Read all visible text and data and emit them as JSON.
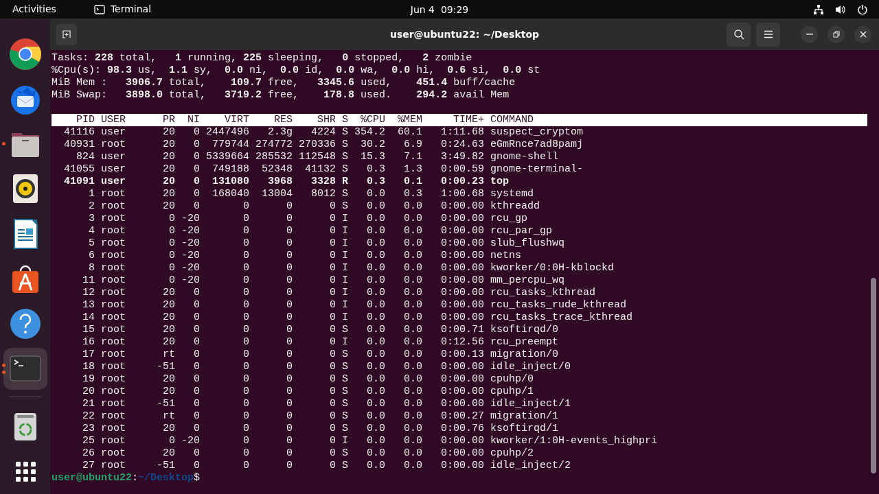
{
  "top_bar": {
    "activities": "Activities",
    "app": "Terminal",
    "clock": "Jun 4  09:29"
  },
  "dock": {
    "items": [
      {
        "kind": "browser",
        "running": false,
        "multiple_windows": false,
        "selected": false
      },
      {
        "kind": "mail",
        "running": false,
        "multiple_windows": false,
        "selected": false
      },
      {
        "kind": "files",
        "running": true,
        "multiple_windows": false,
        "selected": false
      },
      {
        "kind": "music",
        "running": false,
        "multiple_windows": false,
        "selected": false
      },
      {
        "kind": "writer",
        "running": false,
        "multiple_windows": false,
        "selected": false
      },
      {
        "kind": "store",
        "running": false,
        "multiple_windows": false,
        "selected": false
      },
      {
        "kind": "help",
        "running": false,
        "multiple_windows": false,
        "selected": false
      },
      {
        "kind": "terminal",
        "running": true,
        "multiple_windows": true,
        "selected": true
      },
      {
        "kind": "separator"
      },
      {
        "kind": "trash",
        "running": false,
        "multiple_windows": false,
        "selected": false
      },
      {
        "kind": "apps",
        "running": false,
        "multiple_windows": false,
        "selected": false
      }
    ]
  },
  "window": {
    "title": "user@ubuntu22: ~/Desktop"
  },
  "summary": [
    "Tasks: **228** total,   **1** running, **225** sleeping,   **0** stopped,   **2** zombie",
    "%Cpu(s): **98.3** us,  **1.1** sy,  **0.0** ni,  **0.0** id,  **0.0** wa,  **0.0** hi,  **0.6** si,  **0.0** st",
    "MiB Mem :   **3906.7** total,    **109.7** free,   **3345.6** used,    **451.4** buff/cache",
    "MiB Swap:   **3898.0** total,   **3719.2** free,    **178.8** used.    **294.2** avail Mem"
  ],
  "table": {
    "columns": [
      "PID",
      "USER",
      "PR",
      "NI",
      "VIRT",
      "RES",
      "SHR",
      "S",
      "%CPU",
      "%MEM",
      "TIME+",
      "COMMAND"
    ],
    "rows": [
      {
        "cells": [
          "41116",
          "user",
          "20",
          "0",
          "2447496",
          "2.3g",
          "4224",
          "S",
          "354.2",
          "60.1",
          "1:11.68",
          "suspect_cryptom"
        ],
        "highlighted": false
      },
      {
        "cells": [
          "40931",
          "root",
          "20",
          "0",
          "779744",
          "274772",
          "270336",
          "S",
          "30.2",
          "6.9",
          "0:24.63",
          "eGmRnce7ad8pamj"
        ],
        "highlighted": false
      },
      {
        "cells": [
          "824",
          "user",
          "20",
          "0",
          "5339664",
          "285532",
          "112548",
          "S",
          "15.3",
          "7.1",
          "3:49.82",
          "gnome-shell"
        ],
        "highlighted": false
      },
      {
        "cells": [
          "41055",
          "user",
          "20",
          "0",
          "749188",
          "52348",
          "41132",
          "S",
          "0.3",
          "1.3",
          "0:00.59",
          "gnome-terminal-"
        ],
        "highlighted": false
      },
      {
        "cells": [
          "41091",
          "user",
          "20",
          "0",
          "131080",
          "3968",
          "3328",
          "R",
          "0.3",
          "0.1",
          "0:00.23",
          "top"
        ],
        "highlighted": true
      },
      {
        "cells": [
          "1",
          "root",
          "20",
          "0",
          "168040",
          "13004",
          "8012",
          "S",
          "0.0",
          "0.3",
          "1:00.68",
          "systemd"
        ],
        "highlighted": false
      },
      {
        "cells": [
          "2",
          "root",
          "20",
          "0",
          "0",
          "0",
          "0",
          "S",
          "0.0",
          "0.0",
          "0:00.00",
          "kthreadd"
        ],
        "highlighted": false
      },
      {
        "cells": [
          "3",
          "root",
          "0",
          "-20",
          "0",
          "0",
          "0",
          "I",
          "0.0",
          "0.0",
          "0:00.00",
          "rcu_gp"
        ],
        "highlighted": false
      },
      {
        "cells": [
          "4",
          "root",
          "0",
          "-20",
          "0",
          "0",
          "0",
          "I",
          "0.0",
          "0.0",
          "0:00.00",
          "rcu_par_gp"
        ],
        "highlighted": false
      },
      {
        "cells": [
          "5",
          "root",
          "0",
          "-20",
          "0",
          "0",
          "0",
          "I",
          "0.0",
          "0.0",
          "0:00.00",
          "slub_flushwq"
        ],
        "highlighted": false
      },
      {
        "cells": [
          "6",
          "root",
          "0",
          "-20",
          "0",
          "0",
          "0",
          "I",
          "0.0",
          "0.0",
          "0:00.00",
          "netns"
        ],
        "highlighted": false
      },
      {
        "cells": [
          "8",
          "root",
          "0",
          "-20",
          "0",
          "0",
          "0",
          "I",
          "0.0",
          "0.0",
          "0:00.00",
          "kworker/0:0H-kblockd"
        ],
        "highlighted": false
      },
      {
        "cells": [
          "11",
          "root",
          "0",
          "-20",
          "0",
          "0",
          "0",
          "I",
          "0.0",
          "0.0",
          "0:00.00",
          "mm_percpu_wq"
        ],
        "highlighted": false
      },
      {
        "cells": [
          "12",
          "root",
          "20",
          "0",
          "0",
          "0",
          "0",
          "I",
          "0.0",
          "0.0",
          "0:00.00",
          "rcu_tasks_kthread"
        ],
        "highlighted": false
      },
      {
        "cells": [
          "13",
          "root",
          "20",
          "0",
          "0",
          "0",
          "0",
          "I",
          "0.0",
          "0.0",
          "0:00.00",
          "rcu_tasks_rude_kthread"
        ],
        "highlighted": false
      },
      {
        "cells": [
          "14",
          "root",
          "20",
          "0",
          "0",
          "0",
          "0",
          "I",
          "0.0",
          "0.0",
          "0:00.00",
          "rcu_tasks_trace_kthread"
        ],
        "highlighted": false
      },
      {
        "cells": [
          "15",
          "root",
          "20",
          "0",
          "0",
          "0",
          "0",
          "S",
          "0.0",
          "0.0",
          "0:00.71",
          "ksoftirqd/0"
        ],
        "highlighted": false
      },
      {
        "cells": [
          "16",
          "root",
          "20",
          "0",
          "0",
          "0",
          "0",
          "I",
          "0.0",
          "0.0",
          "0:12.56",
          "rcu_preempt"
        ],
        "highlighted": false
      },
      {
        "cells": [
          "17",
          "root",
          "rt",
          "0",
          "0",
          "0",
          "0",
          "S",
          "0.0",
          "0.0",
          "0:00.13",
          "migration/0"
        ],
        "highlighted": false
      },
      {
        "cells": [
          "18",
          "root",
          "-51",
          "0",
          "0",
          "0",
          "0",
          "S",
          "0.0",
          "0.0",
          "0:00.00",
          "idle_inject/0"
        ],
        "highlighted": false
      },
      {
        "cells": [
          "19",
          "root",
          "20",
          "0",
          "0",
          "0",
          "0",
          "S",
          "0.0",
          "0.0",
          "0:00.00",
          "cpuhp/0"
        ],
        "highlighted": false
      },
      {
        "cells": [
          "20",
          "root",
          "20",
          "0",
          "0",
          "0",
          "0",
          "S",
          "0.0",
          "0.0",
          "0:00.00",
          "cpuhp/1"
        ],
        "highlighted": false
      },
      {
        "cells": [
          "21",
          "root",
          "-51",
          "0",
          "0",
          "0",
          "0",
          "S",
          "0.0",
          "0.0",
          "0:00.00",
          "idle_inject/1"
        ],
        "highlighted": false
      },
      {
        "cells": [
          "22",
          "root",
          "rt",
          "0",
          "0",
          "0",
          "0",
          "S",
          "0.0",
          "0.0",
          "0:00.27",
          "migration/1"
        ],
        "highlighted": false
      },
      {
        "cells": [
          "23",
          "root",
          "20",
          "0",
          "0",
          "0",
          "0",
          "S",
          "0.0",
          "0.0",
          "0:00.76",
          "ksoftirqd/1"
        ],
        "highlighted": false
      },
      {
        "cells": [
          "25",
          "root",
          "0",
          "-20",
          "0",
          "0",
          "0",
          "I",
          "0.0",
          "0.0",
          "0:00.00",
          "kworker/1:0H-events_highpri"
        ],
        "highlighted": false
      },
      {
        "cells": [
          "26",
          "root",
          "20",
          "0",
          "0",
          "0",
          "0",
          "S",
          "0.0",
          "0.0",
          "0:00.00",
          "cpuhp/2"
        ],
        "highlighted": false
      },
      {
        "cells": [
          "27",
          "root",
          "-51",
          "0",
          "0",
          "0",
          "0",
          "S",
          "0.0",
          "0.0",
          "0:00.00",
          "idle_inject/2"
        ],
        "highlighted": false
      }
    ]
  },
  "prompt": {
    "user_host": "user@ubuntu22",
    "separator": ":",
    "path": "~/Desktop",
    "symbol": "$"
  }
}
